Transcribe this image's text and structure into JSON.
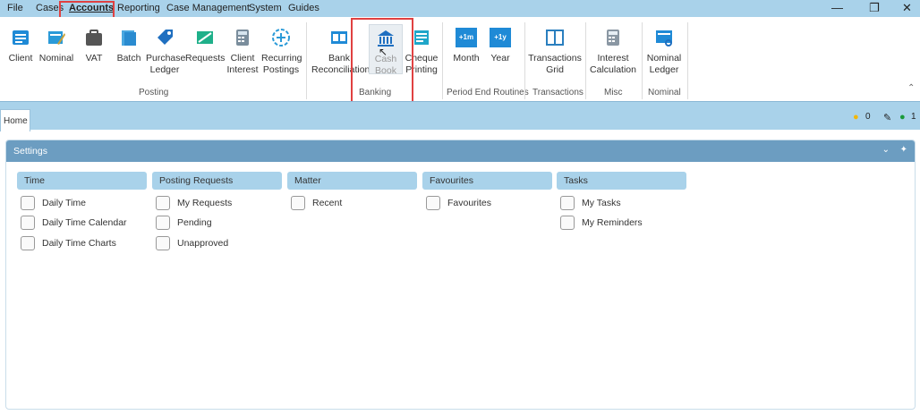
{
  "menubar": {
    "items": [
      "File",
      "Cases",
      "Accounts",
      "Reporting",
      "Case Management",
      "System",
      "Guides"
    ],
    "selected": "Accounts"
  },
  "ribbon": {
    "buttons": [
      {
        "label": "Client",
        "icon": "client-icon"
      },
      {
        "label": "Nominal",
        "icon": "nominal-icon"
      },
      {
        "label": "VAT",
        "icon": "vat-icon"
      },
      {
        "label": "Batch",
        "icon": "batch-icon"
      },
      {
        "label": "Purchase\nLedger",
        "icon": "purchase-ledger-icon"
      },
      {
        "label": "Requests",
        "icon": "requests-icon"
      },
      {
        "label": "Client\nInterest",
        "icon": "client-interest-icon"
      },
      {
        "label": "Recurring\nPostings",
        "icon": "recurring-postings-icon"
      },
      {
        "label": "Bank\nReconciliation",
        "icon": "bank-reconciliation-icon"
      },
      {
        "label": "Cash\nBook",
        "icon": "cash-book-icon"
      },
      {
        "label": "Cheque\nPrinting",
        "icon": "cheque-printing-icon"
      },
      {
        "label": "Month",
        "icon": "month-icon",
        "badge": "+1m"
      },
      {
        "label": "Year",
        "icon": "year-icon",
        "badge": "+1y"
      },
      {
        "label": "Transactions\nGrid",
        "icon": "transactions-grid-icon"
      },
      {
        "label": "Interest\nCalculation",
        "icon": "calculator-icon"
      },
      {
        "label": "Nominal\nLedger",
        "icon": "nominal-ledger-icon"
      }
    ],
    "groups": [
      "Posting",
      "Banking",
      "Period End Routines",
      "Transactions",
      "Misc",
      "Nominal"
    ]
  },
  "tabs": {
    "home": "Home"
  },
  "status": {
    "warnings": "0",
    "online": "1"
  },
  "settings": {
    "title": "Settings",
    "columns": [
      {
        "title": "Time",
        "items": [
          "Daily Time",
          "Daily Time Calendar",
          "Daily Time Charts"
        ]
      },
      {
        "title": "Posting Requests",
        "items": [
          "My Requests",
          "Pending",
          "Unapproved"
        ]
      },
      {
        "title": "Matter",
        "items": [
          "Recent"
        ]
      },
      {
        "title": "Favourites",
        "items": [
          "Favourites"
        ]
      },
      {
        "title": "Tasks",
        "items": [
          "My Tasks",
          "My Reminders"
        ]
      }
    ]
  },
  "colors": {
    "accent": "#a9d2ea",
    "header": "#6c9dc1",
    "highlight": "#e04141",
    "icon": "#1f8ad6"
  }
}
